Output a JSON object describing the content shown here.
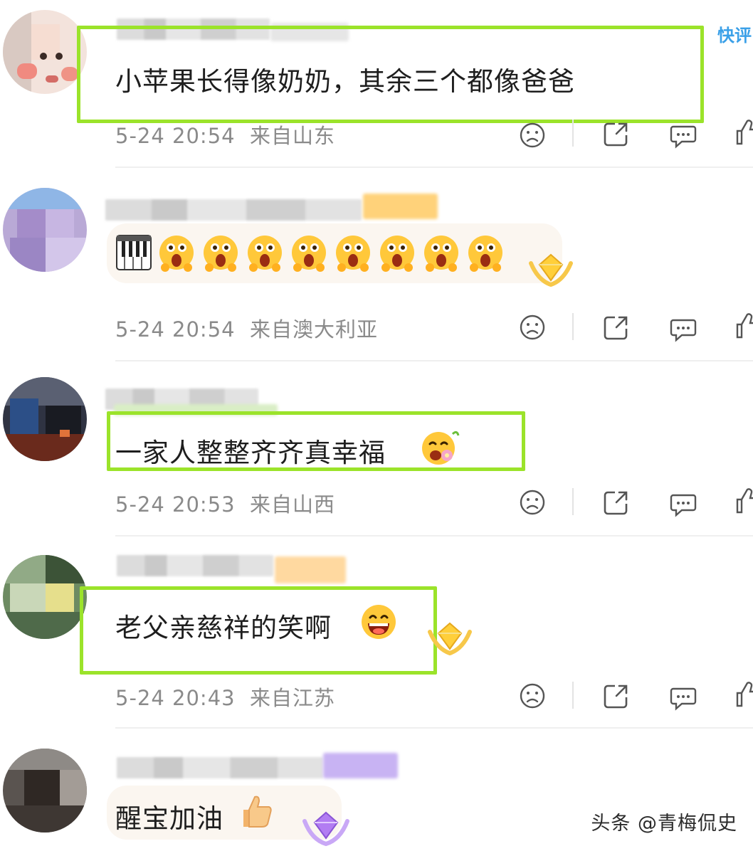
{
  "corner_label": "快评",
  "comments": [
    {
      "text": "小苹果长得像奶奶，其余三个都像爸爸",
      "date": "5-24 20:54",
      "location": "来自山东"
    },
    {
      "text": "",
      "date": "5-24 20:54",
      "location": "来自澳大利亚",
      "emojis": [
        "piano-emoji",
        "awe-face-emoji",
        "awe-face-emoji",
        "awe-face-emoji",
        "awe-face-emoji",
        "awe-face-emoji",
        "awe-face-emoji",
        "awe-face-emoji",
        "awe-face-emoji"
      ]
    },
    {
      "text": "一家人整整齐齐真幸福",
      "date": "5-24 20:53",
      "location": "来自山西"
    },
    {
      "text": "老父亲慈祥的笑啊",
      "date": "5-24 20:43",
      "location": "来自江苏"
    },
    {
      "text": "醒宝加油"
    }
  ],
  "action_icons": [
    "dislike-face-icon",
    "share-icon",
    "reply-icon",
    "like-icon"
  ],
  "watermark": "头条 @青梅侃史",
  "colors": {
    "highlight": "#9be32a",
    "meta": "#8a8a8a",
    "emoji_yellow": "#ffc83a"
  }
}
